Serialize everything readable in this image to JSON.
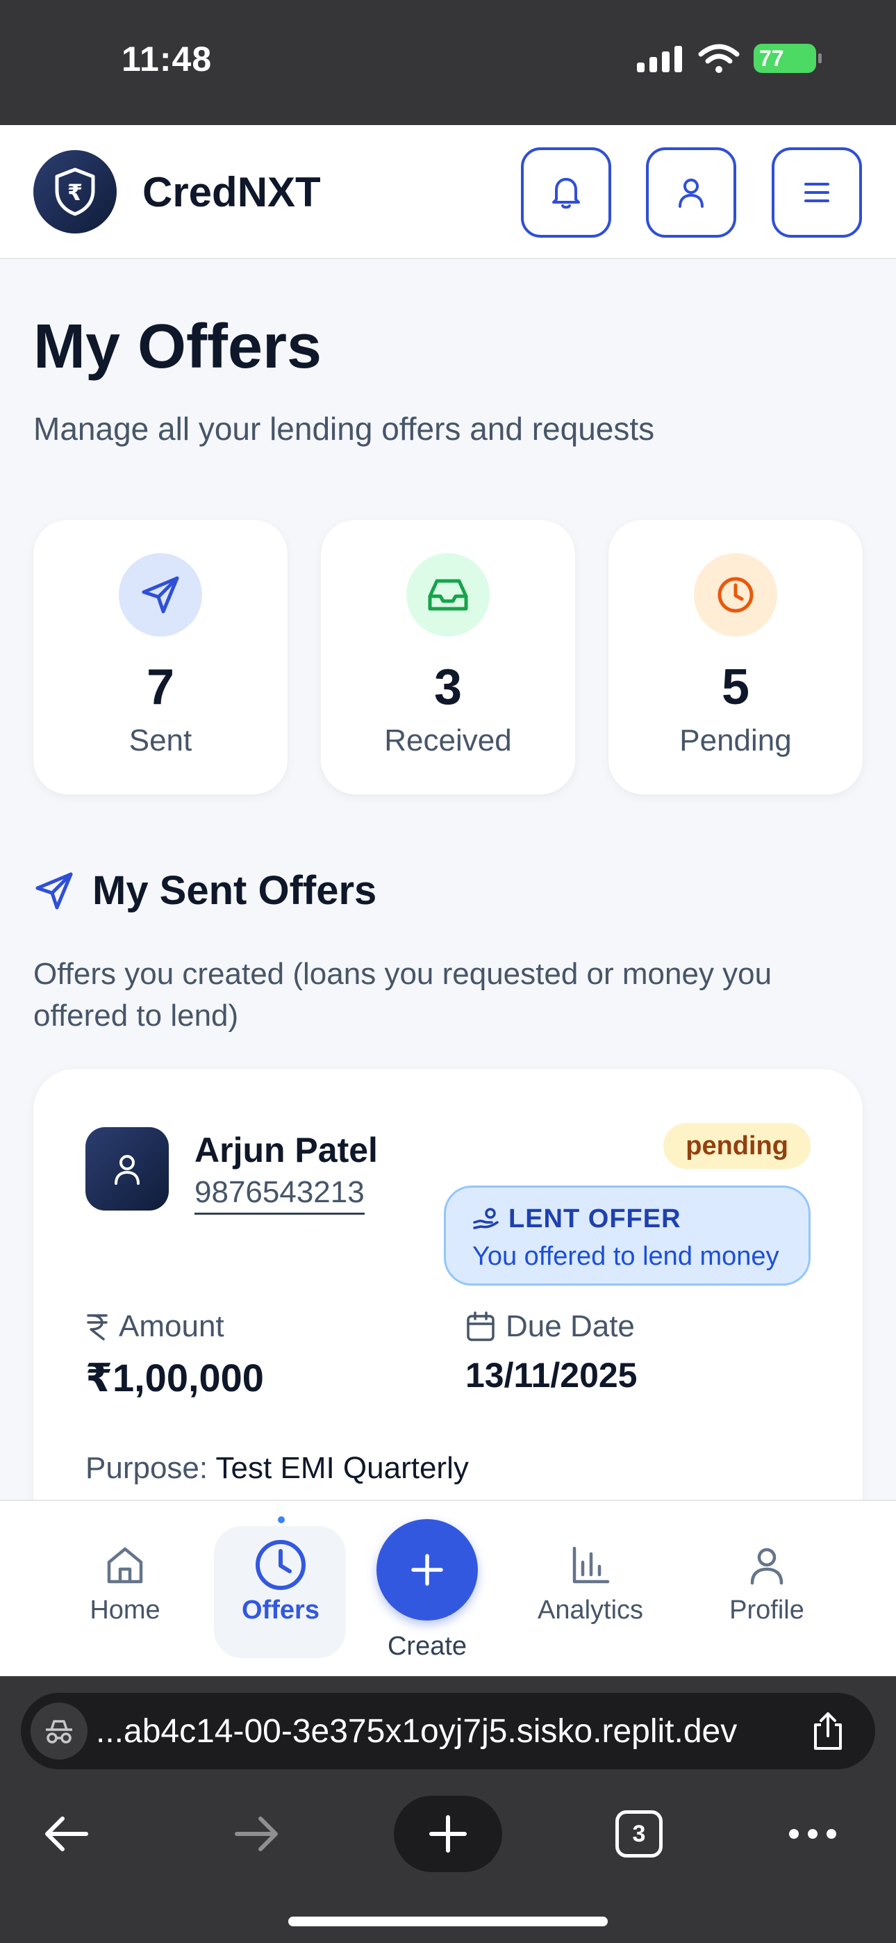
{
  "status_bar": {
    "time": "11:48",
    "battery": "77"
  },
  "header": {
    "brand": "CredNXT",
    "logo_symbol": "₹",
    "icons": [
      "bell-icon",
      "user-icon",
      "menu-icon"
    ]
  },
  "page": {
    "title": "My Offers",
    "subtitle": "Manage all your lending offers and requests"
  },
  "stats": [
    {
      "value": "7",
      "label": "Sent",
      "icon": "send-icon",
      "icon_bg": "#dbe6fd",
      "icon_color": "#2f4fd6"
    },
    {
      "value": "3",
      "label": "Received",
      "icon": "inbox-icon",
      "icon_bg": "#dcfce7",
      "icon_color": "#16a34a"
    },
    {
      "value": "5",
      "label": "Pending",
      "icon": "clock-icon",
      "icon_bg": "#ffedd5",
      "icon_color": "#ea580c"
    }
  ],
  "section": {
    "title": "My Sent Offers",
    "description": "Offers you created (loans you requested or money you offered to lend)"
  },
  "offer": {
    "name": "Arjun Patel",
    "phone": "9876543213",
    "status": "pending",
    "type_label": "LENT OFFER",
    "type_desc": "You offered to lend money",
    "amount_label": "Amount",
    "amount": "₹1,00,000",
    "due_label": "Due Date",
    "due_date": "13/11/2025",
    "purpose_label": "Purpose:",
    "purpose": "Test EMI Quarterly"
  },
  "bottom_nav": {
    "home": "Home",
    "offers": "Offers",
    "create": "Create",
    "analytics": "Analytics",
    "profile": "Profile",
    "active": "offers"
  },
  "browser": {
    "url": "...ab4c14-00-3e375x1oyj7j5.sisko.replit.dev",
    "tab_count": "3"
  },
  "colors": {
    "accent": "#3358e0",
    "brand_dark": "#0f1c3a",
    "pending_bg": "#fef3c7"
  }
}
